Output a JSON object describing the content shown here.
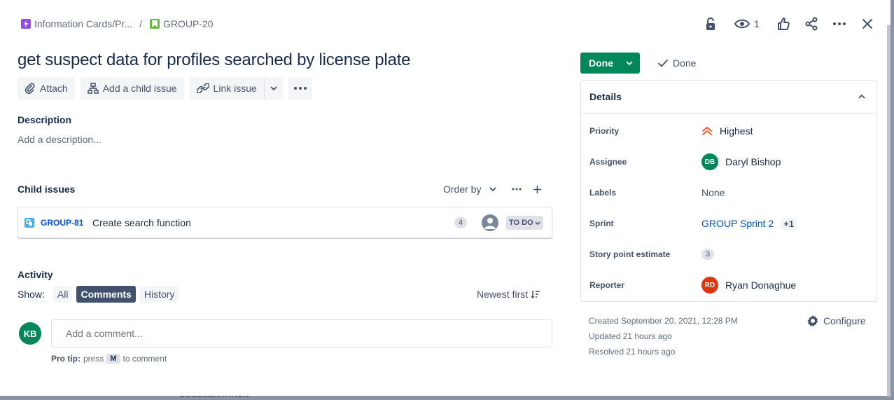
{
  "breadcrumb": {
    "parent": "Information Cards/Pr...",
    "separator": "/",
    "issue_key": "GROUP-20"
  },
  "header": {
    "watch_count": "1"
  },
  "issue": {
    "title": "get suspect data for profiles searched by license plate"
  },
  "toolbar": {
    "attach": "Attach",
    "add_child": "Add a child issue",
    "link_issue": "Link issue"
  },
  "description": {
    "label": "Description",
    "placeholder": "Add a description..."
  },
  "child_issues": {
    "label": "Child issues",
    "order_by": "Order by",
    "items": [
      {
        "key": "GROUP-81",
        "summary": "Create search function",
        "story_points": "4",
        "status": "TO DO"
      }
    ]
  },
  "activity": {
    "label": "Activity",
    "show_label": "Show:",
    "filters": [
      "All",
      "Comments",
      "History"
    ],
    "active_filter": "Comments",
    "sort": "Newest first",
    "user_initials": "KB",
    "comment_placeholder": "Add a comment...",
    "protip_label": "Pro tip:",
    "protip_press": "press",
    "protip_key": "M",
    "protip_suffix": "to comment"
  },
  "status": {
    "button": "Done",
    "resolution": "Done"
  },
  "details": {
    "heading": "Details",
    "priority_label": "Priority",
    "priority": "Highest",
    "assignee_label": "Assignee",
    "assignee_initials": "DB",
    "assignee": "Daryl Bishop",
    "labels_label": "Labels",
    "labels": "None",
    "sprint_label": "Sprint",
    "sprint": "GROUP Sprint 2",
    "sprint_more": "+1",
    "spe_label": "Story point estimate",
    "spe": "3",
    "reporter_label": "Reporter",
    "reporter_initials": "RD",
    "reporter": "Ryan Donaghue"
  },
  "meta": {
    "created": "Created September 20, 2021, 12:28 PM",
    "updated": "Updated 21 hours ago",
    "resolved": "Resolved 21 hours ago",
    "configure": "Configure"
  },
  "backdrop": {
    "text": "DOCUMENTATION"
  },
  "colors": {
    "primary": "#0052cc",
    "done": "#00875a",
    "priority_highest": "#ff5630",
    "reporter_avatar": "#de350b",
    "assignee_avatar": "#00875a"
  }
}
